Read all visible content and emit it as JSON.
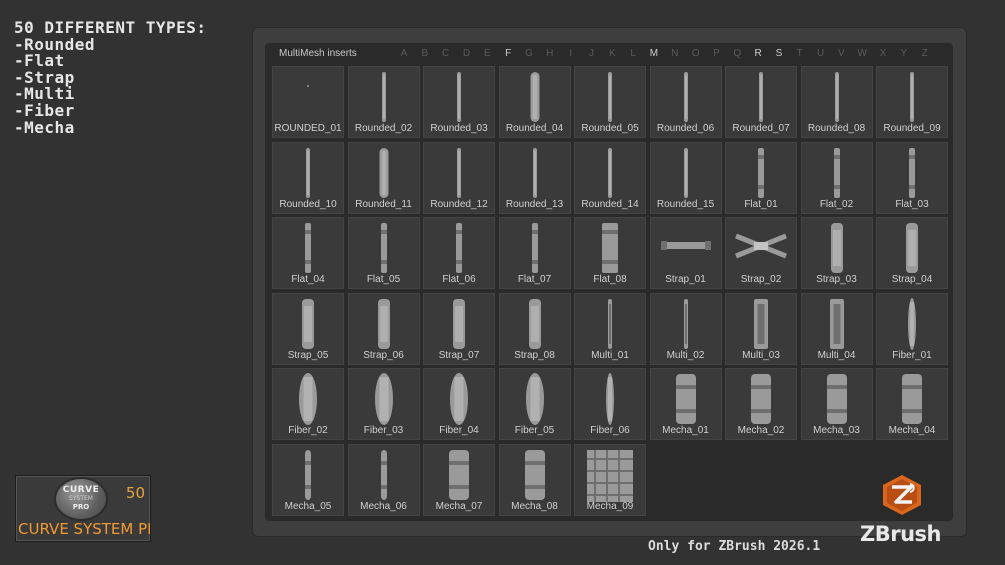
{
  "promo": {
    "heading": "50 DIFFERENT TYPES:",
    "types": [
      "-Rounded",
      "-Flat",
      "-Strap",
      "-Multi",
      "-Fiber",
      "-Mecha"
    ]
  },
  "palette": {
    "title": "MultiMesh inserts",
    "letters": [
      "A",
      "B",
      "C",
      "D",
      "E",
      "F",
      "G",
      "H",
      "I",
      "J",
      "K",
      "L",
      "M",
      "N",
      "O",
      "P",
      "Q",
      "R",
      "S",
      "T",
      "U",
      "V",
      "W",
      "X",
      "Y",
      "Z"
    ],
    "active_letters": [
      "F",
      "M",
      "R",
      "S"
    ],
    "items": [
      "ROUNDED_01",
      "Rounded_02",
      "Rounded_03",
      "Rounded_04",
      "Rounded_05",
      "Rounded_06",
      "Rounded_07",
      "Rounded_08",
      "Rounded_09",
      "Rounded_10",
      "Rounded_11",
      "Rounded_12",
      "Rounded_13",
      "Rounded_14",
      "Rounded_15",
      "Flat_01",
      "Flat_02",
      "Flat_03",
      "Flat_04",
      "Flat_05",
      "Flat_06",
      "Flat_07",
      "Flat_08",
      "Strap_01",
      "Strap_02",
      "Strap_03",
      "Strap_04",
      "Strap_05",
      "Strap_06",
      "Strap_07",
      "Strap_08",
      "Multi_01",
      "Multi_02",
      "Multi_03",
      "Multi_04",
      "Fiber_01",
      "Fiber_02",
      "Fiber_03",
      "Fiber_04",
      "Fiber_05",
      "Fiber_06",
      "Mecha_01",
      "Mecha_02",
      "Mecha_03",
      "Mecha_04",
      "Mecha_05",
      "Mecha_06",
      "Mecha_07",
      "Mecha_08",
      "Mecha_09"
    ]
  },
  "badge": {
    "logo_line1": "CURVE",
    "logo_line2": "SYSTEM",
    "logo_line3": "PRO",
    "count": "50",
    "name": "CURVE SYSTEM PRO"
  },
  "brand": {
    "name": "ZBrush",
    "accent": "#e06a1b"
  },
  "footer": {
    "text": "Only for ZBrush 2026.1"
  }
}
